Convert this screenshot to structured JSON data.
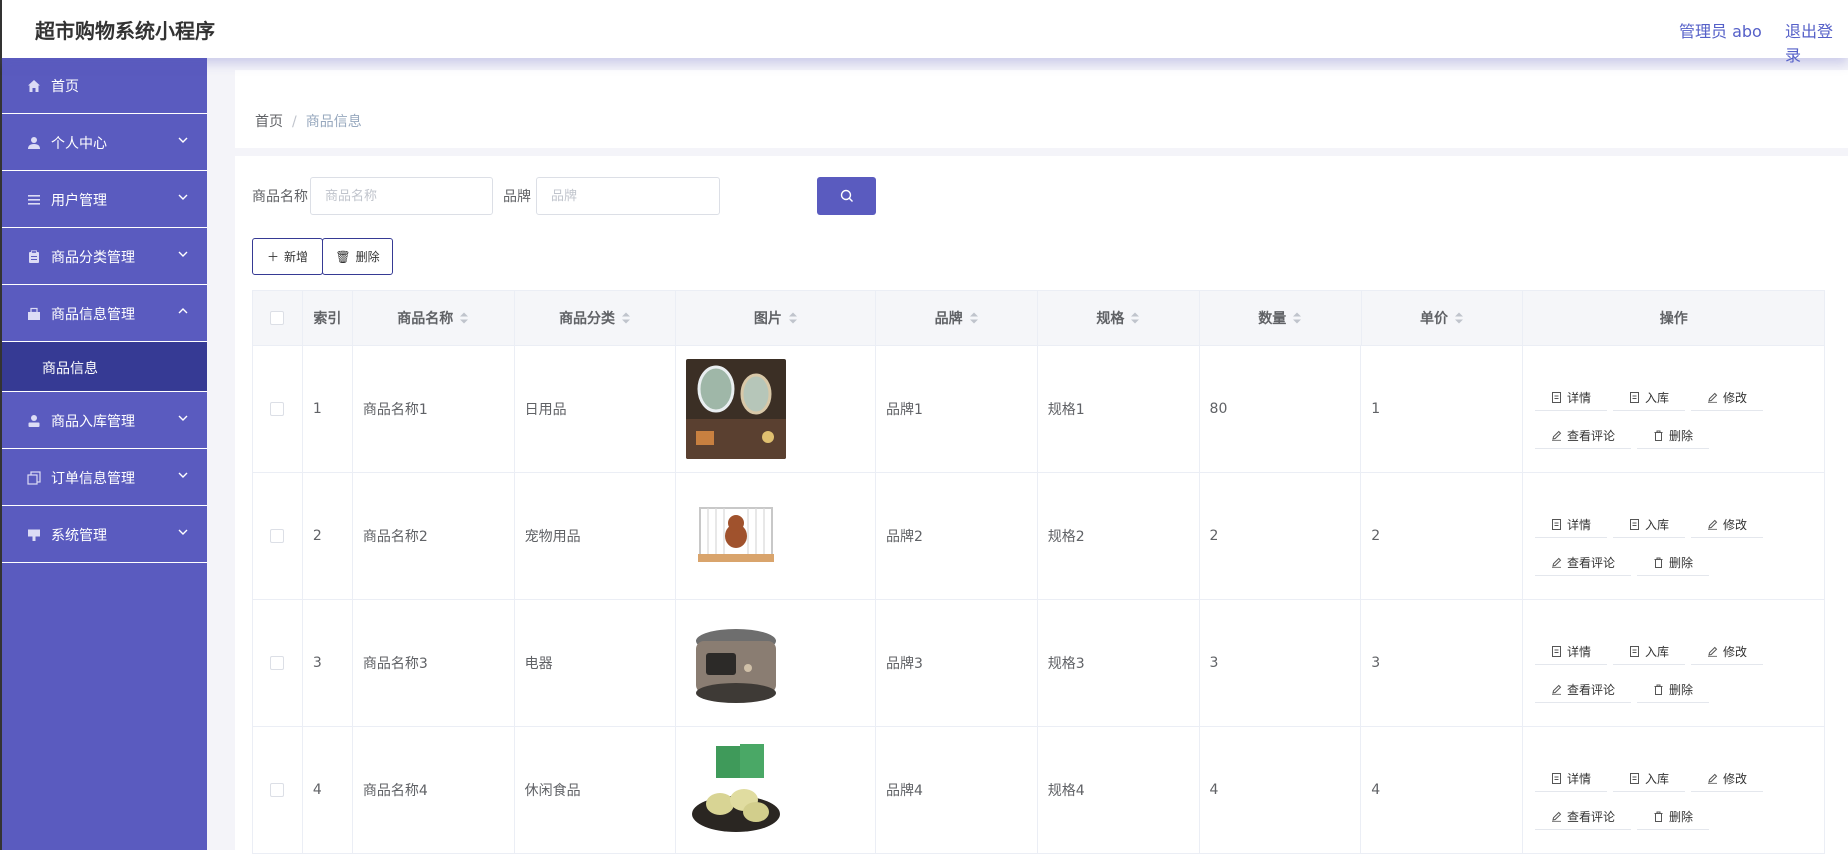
{
  "header": {
    "title": "超市购物系统小程序",
    "admin": "管理员 abo",
    "logout": "退出登录"
  },
  "sidebar": {
    "items": [
      {
        "label": "首页",
        "icon": "home-icon"
      },
      {
        "label": "个人中心",
        "icon": "user-icon"
      },
      {
        "label": "用户管理",
        "icon": "list-icon"
      },
      {
        "label": "商品分类管理",
        "icon": "clipboard-icon"
      },
      {
        "label": "商品信息管理",
        "icon": "goods-icon"
      },
      {
        "label": "商品入库管理",
        "icon": "person-icon"
      },
      {
        "label": "订单信息管理",
        "icon": "copy-icon"
      },
      {
        "label": "系统管理",
        "icon": "settings-icon"
      }
    ],
    "submenu": {
      "label": "商品信息"
    }
  },
  "breadcrumb": {
    "home": "首页",
    "separator": "/",
    "current": "商品信息"
  },
  "search": {
    "name_label": "商品名称",
    "name_placeholder": "商品名称",
    "brand_label": "品牌",
    "brand_placeholder": "品牌"
  },
  "actions": {
    "add": "新增",
    "delete": "删除"
  },
  "table": {
    "headers": {
      "index": "索引",
      "name": "商品名称",
      "category": "商品分类",
      "image": "图片",
      "brand": "品牌",
      "spec": "规格",
      "qty": "数量",
      "price": "单价",
      "ops": "操作"
    },
    "op_labels": {
      "detail": "详情",
      "stock_in": "入库",
      "edit": "修改",
      "reviews": "查看评论",
      "delete": "删除"
    },
    "rows": [
      {
        "index": "1",
        "name": "商品名称1",
        "category": "日用品",
        "brand": "品牌1",
        "spec": "规格1",
        "qty": "80",
        "price": "1"
      },
      {
        "index": "2",
        "name": "商品名称2",
        "category": "宠物用品",
        "brand": "品牌2",
        "spec": "规格2",
        "qty": "2",
        "price": "2"
      },
      {
        "index": "3",
        "name": "商品名称3",
        "category": "电器",
        "brand": "品牌3",
        "spec": "规格3",
        "qty": "3",
        "price": "3"
      },
      {
        "index": "4",
        "name": "商品名称4",
        "category": "休闲食品",
        "brand": "品牌4",
        "spec": "规格4",
        "qty": "4",
        "price": "4"
      }
    ]
  },
  "colors": {
    "primary": "#5a5bbf",
    "sidebar_active": "#363a94",
    "accent_text": "#5560c8"
  }
}
